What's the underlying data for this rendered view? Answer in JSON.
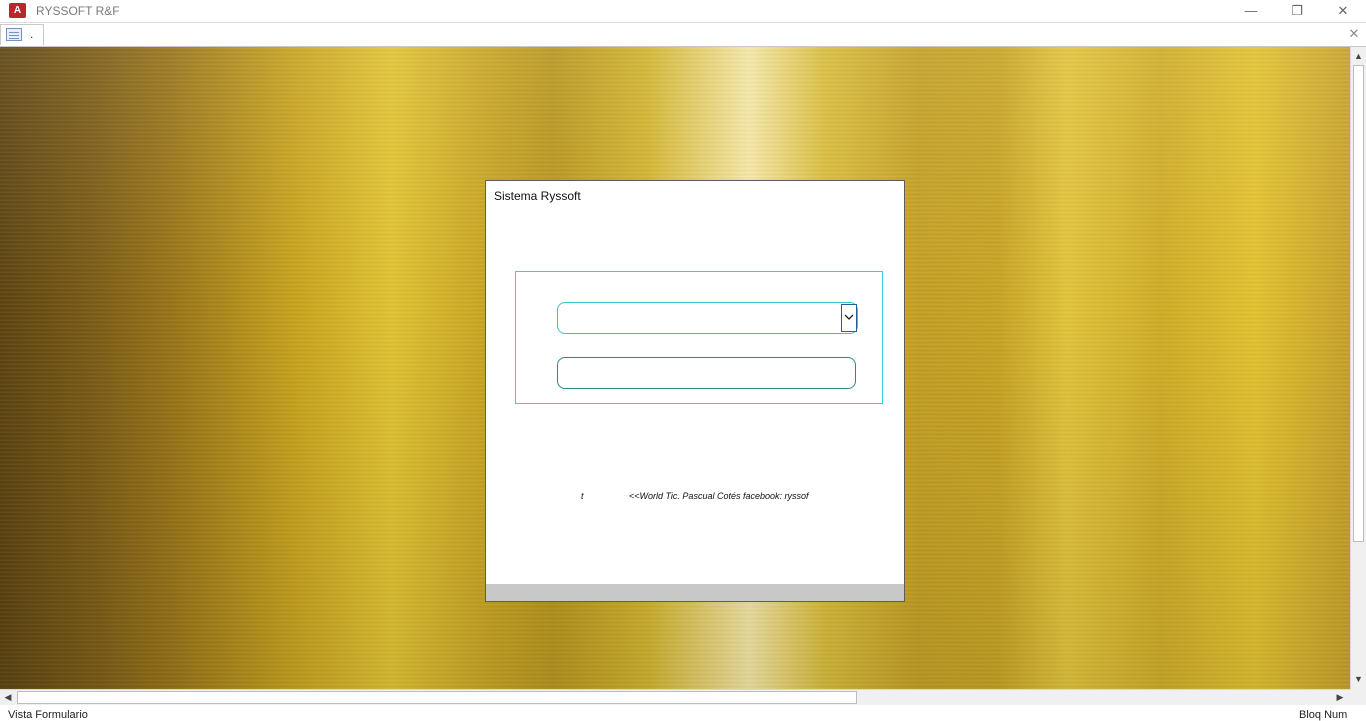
{
  "window": {
    "title": "RYSSOFT R&F",
    "app_icon_letter": "A",
    "minimize": "—",
    "restore": "❐",
    "close": "✕"
  },
  "tab": {
    "label": ".",
    "close": "✕"
  },
  "form": {
    "title": "Sistema Ryssoft",
    "user_combo_value": "",
    "password_value": "",
    "footer_left": "t",
    "footer_credit": "<<World Tic. Pascual Cotés facebook: ryssof"
  },
  "status": {
    "left": "Vista Formulario",
    "right": "Bloq Num"
  },
  "colors": {
    "accent_cyan": "#2ed4d4",
    "dropdown_border": "#1f5f9a",
    "app_icon": "#b7272d"
  }
}
